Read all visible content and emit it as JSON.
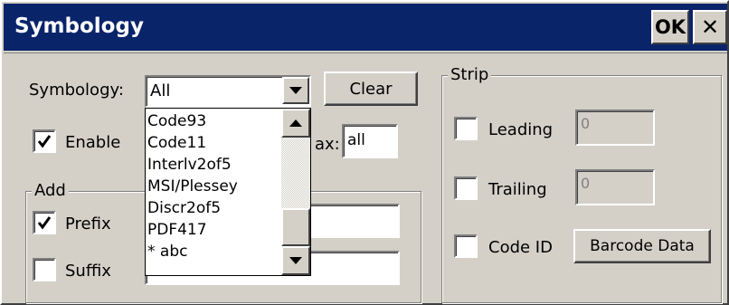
{
  "window": {
    "title": "Symbology",
    "ok_label": "OK",
    "close_label": "✕"
  },
  "symbology": {
    "label": "Symbology:",
    "selected": "All",
    "clear_label": "Clear",
    "dropdown_items": [
      "Code93",
      "Code11",
      "Interlv2of5",
      "MSI/Plessey",
      "Discr2of5",
      "PDF417",
      "* abc"
    ]
  },
  "enable": {
    "label": "Enable",
    "checked": true
  },
  "max": {
    "label_visible": "ax:",
    "value": "all"
  },
  "add_group": {
    "title": "Add",
    "prefix": {
      "label": "Prefix",
      "checked": true,
      "value": ""
    },
    "suffix": {
      "label": "Suffix",
      "checked": false,
      "value": ""
    }
  },
  "strip_group": {
    "title": "Strip",
    "leading": {
      "label": "Leading",
      "checked": false,
      "value": "0"
    },
    "trailing": {
      "label": "Trailing",
      "checked": false,
      "value": "0"
    },
    "code_id": {
      "label": "Code ID",
      "checked": false
    },
    "barcode_data_label": "Barcode Data"
  },
  "colors": {
    "titlebar": "#0a246a",
    "face": "#d4d0c8"
  }
}
